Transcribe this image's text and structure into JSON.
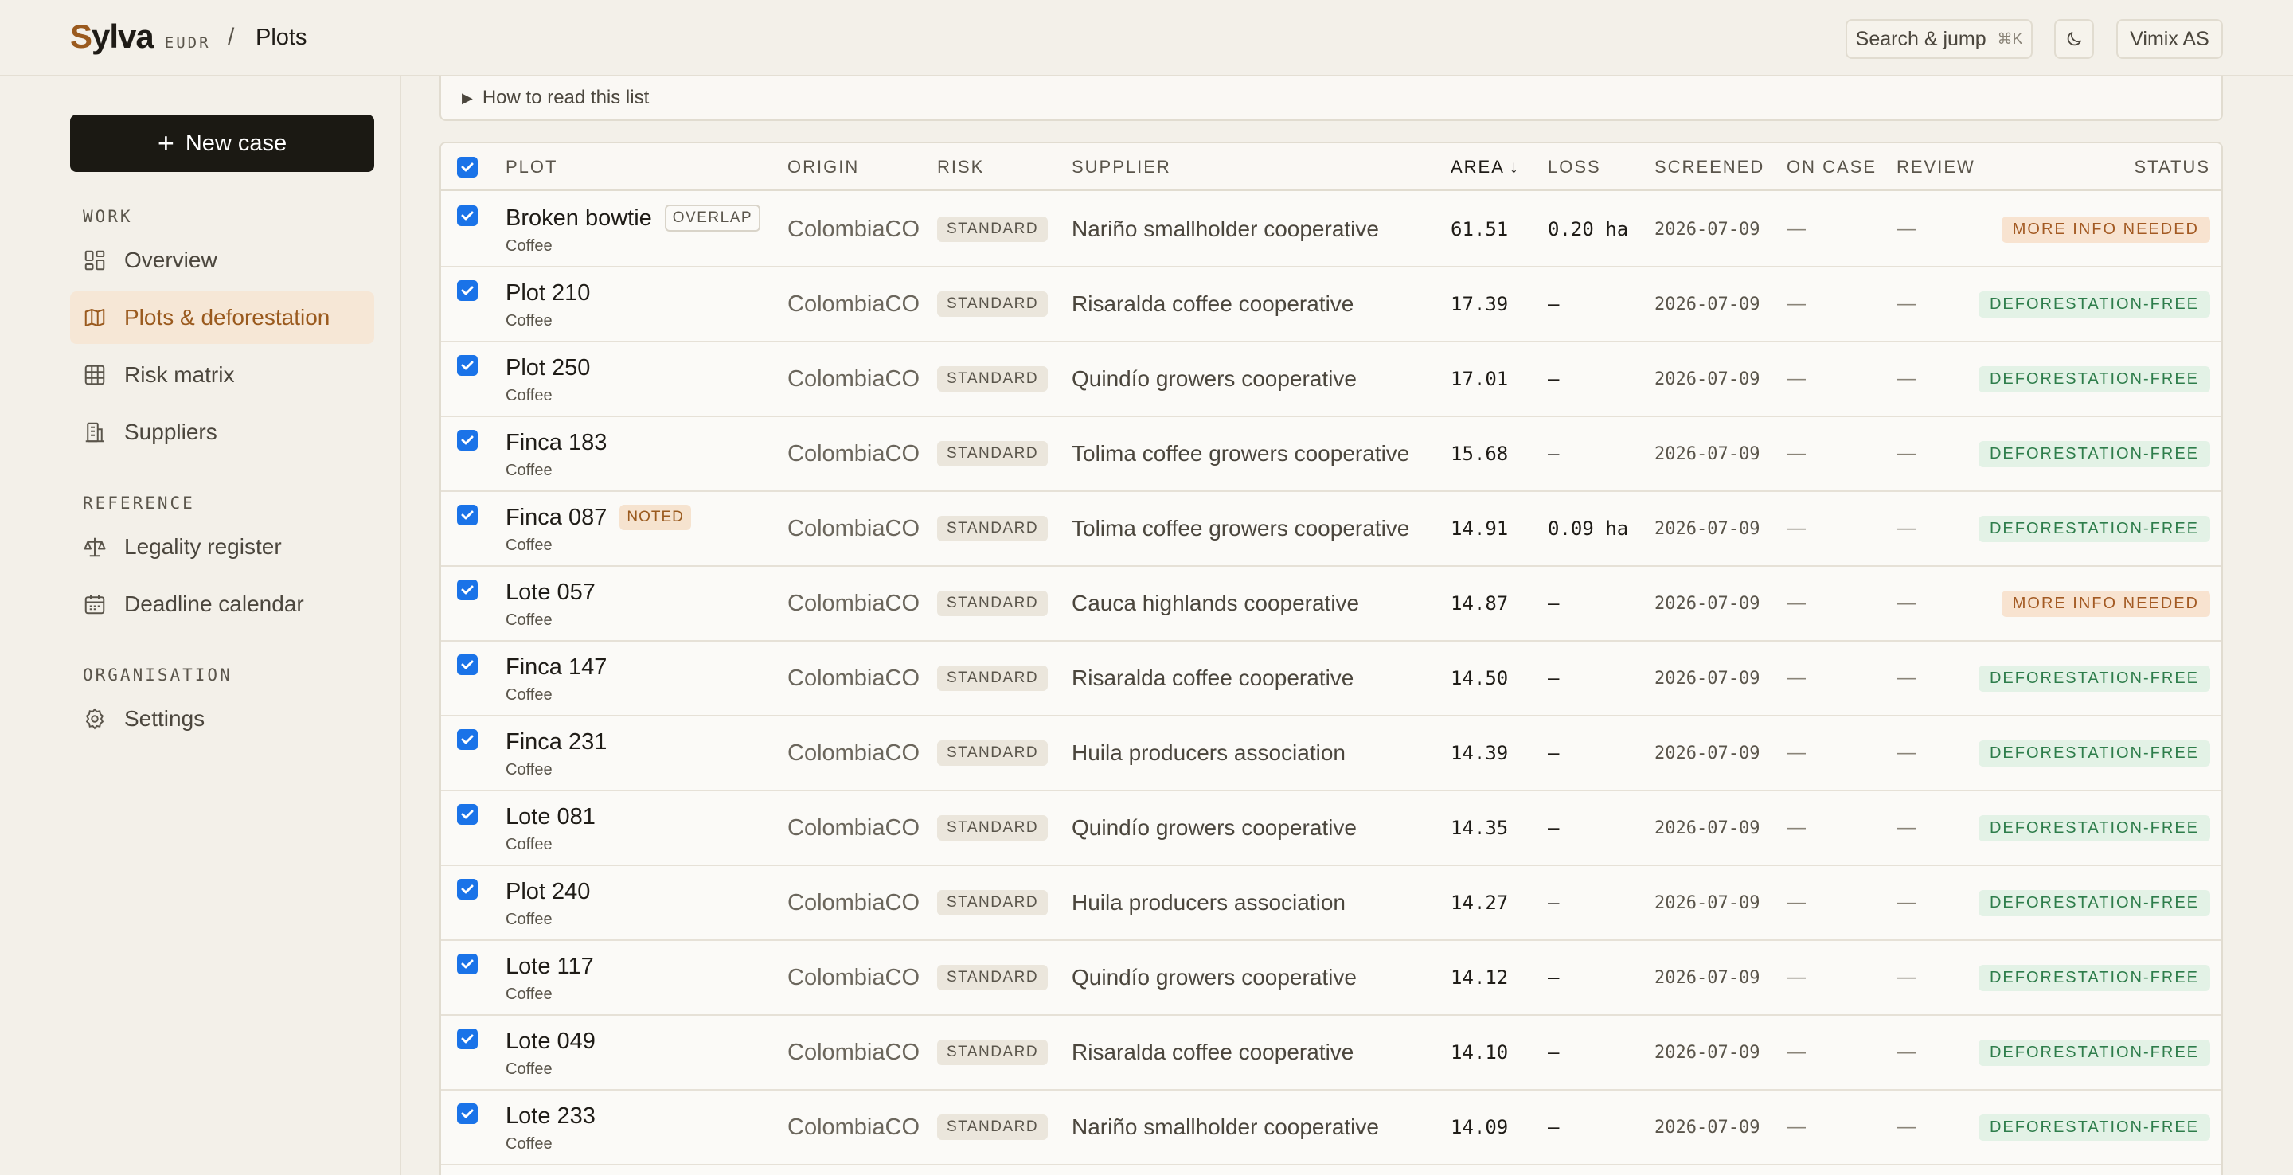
{
  "topbar": {
    "logo_s": "S",
    "logo_rest": "ylva",
    "logo_tag": "EUDR",
    "separator": "/",
    "page": "Plots",
    "search_label": "Search & jump",
    "search_kbd": "⌘K",
    "org": "Vimix AS"
  },
  "sidebar": {
    "new_case": "New case",
    "sections": {
      "work": "WORK",
      "reference": "REFERENCE",
      "organisation": "ORGANISATION"
    },
    "items": [
      {
        "label": "Overview",
        "icon": "layout-icon"
      },
      {
        "label": "Plots & deforestation",
        "icon": "map-icon",
        "active": true
      },
      {
        "label": "Risk matrix",
        "icon": "grid-icon"
      },
      {
        "label": "Suppliers",
        "icon": "building-icon"
      },
      {
        "label": "Legality register",
        "icon": "scale-icon"
      },
      {
        "label": "Deadline calendar",
        "icon": "calendar-icon"
      },
      {
        "label": "Settings",
        "icon": "gear-icon"
      }
    ]
  },
  "main": {
    "howto": "How to read this list",
    "columns": {
      "plot": "PLOT",
      "origin": "ORIGIN",
      "risk": "RISK",
      "supplier": "SUPPLIER",
      "area": "AREA",
      "area_sort": "↓",
      "loss": "LOSS",
      "screened": "SCREENED",
      "on_case": "ON CASE",
      "review": "REVIEW",
      "status": "STATUS"
    },
    "rows": [
      {
        "name": "Broken bowtie",
        "tag": "OVERLAP",
        "sub": "Coffee",
        "origin": "Colombia",
        "cc": "CO",
        "risk": "STANDARD",
        "supplier": "Nariño smallholder cooperative",
        "area": "61.51",
        "loss": "0.20 ha",
        "screened": "2026-07-09",
        "on_case": "—",
        "review": "—",
        "status": "MORE INFO NEEDED",
        "status_kind": "info"
      },
      {
        "name": "Plot 210",
        "tag": "",
        "sub": "Coffee",
        "origin": "Colombia",
        "cc": "CO",
        "risk": "STANDARD",
        "supplier": "Risaralda coffee cooperative",
        "area": "17.39",
        "loss": "—",
        "screened": "2026-07-09",
        "on_case": "—",
        "review": "—",
        "status": "DEFORESTATION-FREE",
        "status_kind": "free"
      },
      {
        "name": "Plot 250",
        "tag": "",
        "sub": "Coffee",
        "origin": "Colombia",
        "cc": "CO",
        "risk": "STANDARD",
        "supplier": "Quindío growers cooperative",
        "area": "17.01",
        "loss": "—",
        "screened": "2026-07-09",
        "on_case": "—",
        "review": "—",
        "status": "DEFORESTATION-FREE",
        "status_kind": "free"
      },
      {
        "name": "Finca 183",
        "tag": "",
        "sub": "Coffee",
        "origin": "Colombia",
        "cc": "CO",
        "risk": "STANDARD",
        "supplier": "Tolima coffee growers cooperative",
        "area": "15.68",
        "loss": "—",
        "screened": "2026-07-09",
        "on_case": "—",
        "review": "—",
        "status": "DEFORESTATION-FREE",
        "status_kind": "free"
      },
      {
        "name": "Finca 087",
        "tag": "NOTED",
        "sub": "Coffee",
        "origin": "Colombia",
        "cc": "CO",
        "risk": "STANDARD",
        "supplier": "Tolima coffee growers cooperative",
        "area": "14.91",
        "loss": "0.09 ha",
        "screened": "2026-07-09",
        "on_case": "—",
        "review": "—",
        "status": "DEFORESTATION-FREE",
        "status_kind": "free"
      },
      {
        "name": "Lote 057",
        "tag": "",
        "sub": "Coffee",
        "origin": "Colombia",
        "cc": "CO",
        "risk": "STANDARD",
        "supplier": "Cauca highlands cooperative",
        "area": "14.87",
        "loss": "—",
        "screened": "2026-07-09",
        "on_case": "—",
        "review": "—",
        "status": "MORE INFO NEEDED",
        "status_kind": "info"
      },
      {
        "name": "Finca 147",
        "tag": "",
        "sub": "Coffee",
        "origin": "Colombia",
        "cc": "CO",
        "risk": "STANDARD",
        "supplier": "Risaralda coffee cooperative",
        "area": "14.50",
        "loss": "—",
        "screened": "2026-07-09",
        "on_case": "—",
        "review": "—",
        "status": "DEFORESTATION-FREE",
        "status_kind": "free"
      },
      {
        "name": "Finca 231",
        "tag": "",
        "sub": "Coffee",
        "origin": "Colombia",
        "cc": "CO",
        "risk": "STANDARD",
        "supplier": "Huila producers association",
        "area": "14.39",
        "loss": "—",
        "screened": "2026-07-09",
        "on_case": "—",
        "review": "—",
        "status": "DEFORESTATION-FREE",
        "status_kind": "free"
      },
      {
        "name": "Lote 081",
        "tag": "",
        "sub": "Coffee",
        "origin": "Colombia",
        "cc": "CO",
        "risk": "STANDARD",
        "supplier": "Quindío growers cooperative",
        "area": "14.35",
        "loss": "—",
        "screened": "2026-07-09",
        "on_case": "—",
        "review": "—",
        "status": "DEFORESTATION-FREE",
        "status_kind": "free"
      },
      {
        "name": "Plot 240",
        "tag": "",
        "sub": "Coffee",
        "origin": "Colombia",
        "cc": "CO",
        "risk": "STANDARD",
        "supplier": "Huila producers association",
        "area": "14.27",
        "loss": "—",
        "screened": "2026-07-09",
        "on_case": "—",
        "review": "—",
        "status": "DEFORESTATION-FREE",
        "status_kind": "free"
      },
      {
        "name": "Lote 117",
        "tag": "",
        "sub": "Coffee",
        "origin": "Colombia",
        "cc": "CO",
        "risk": "STANDARD",
        "supplier": "Quindío growers cooperative",
        "area": "14.12",
        "loss": "—",
        "screened": "2026-07-09",
        "on_case": "—",
        "review": "—",
        "status": "DEFORESTATION-FREE",
        "status_kind": "free"
      },
      {
        "name": "Lote 049",
        "tag": "",
        "sub": "Coffee",
        "origin": "Colombia",
        "cc": "CO",
        "risk": "STANDARD",
        "supplier": "Risaralda coffee cooperative",
        "area": "14.10",
        "loss": "—",
        "screened": "2026-07-09",
        "on_case": "—",
        "review": "—",
        "status": "DEFORESTATION-FREE",
        "status_kind": "free"
      },
      {
        "name": "Lote 233",
        "tag": "",
        "sub": "Coffee",
        "origin": "Colombia",
        "cc": "CO",
        "risk": "STANDARD",
        "supplier": "Nariño smallholder cooperative",
        "area": "14.09",
        "loss": "—",
        "screened": "2026-07-09",
        "on_case": "—",
        "review": "—",
        "status": "DEFORESTATION-FREE",
        "status_kind": "free"
      }
    ]
  }
}
